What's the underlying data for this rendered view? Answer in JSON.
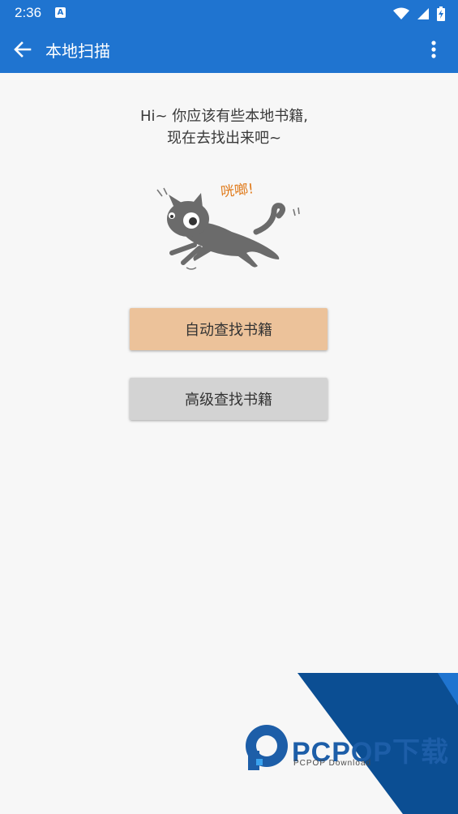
{
  "status_bar": {
    "time": "2:36",
    "notification_icon_letter": "A",
    "icons": [
      "wifi-icon",
      "signal-icon",
      "battery-icon"
    ]
  },
  "toolbar": {
    "title": "本地扫描",
    "back_icon": "arrow-left-icon",
    "menu_icon": "more-vertical-icon"
  },
  "intro": {
    "line1": "Hi~ 你应该有些本地书籍,",
    "line2": "现在去找出来吧~"
  },
  "illustration": {
    "caption": "咣啷!"
  },
  "buttons": {
    "auto_search": "自动查找书籍",
    "advanced_search": "高级查找书籍"
  },
  "watermark": {
    "brand": "PCPOP下载",
    "sub": "PCPOP Download"
  },
  "colors": {
    "primary": "#1f74d0",
    "auto_button": "#ecc29a",
    "advanced_button": "#d3d3d3",
    "watermark_blue": "#0b4e93"
  }
}
